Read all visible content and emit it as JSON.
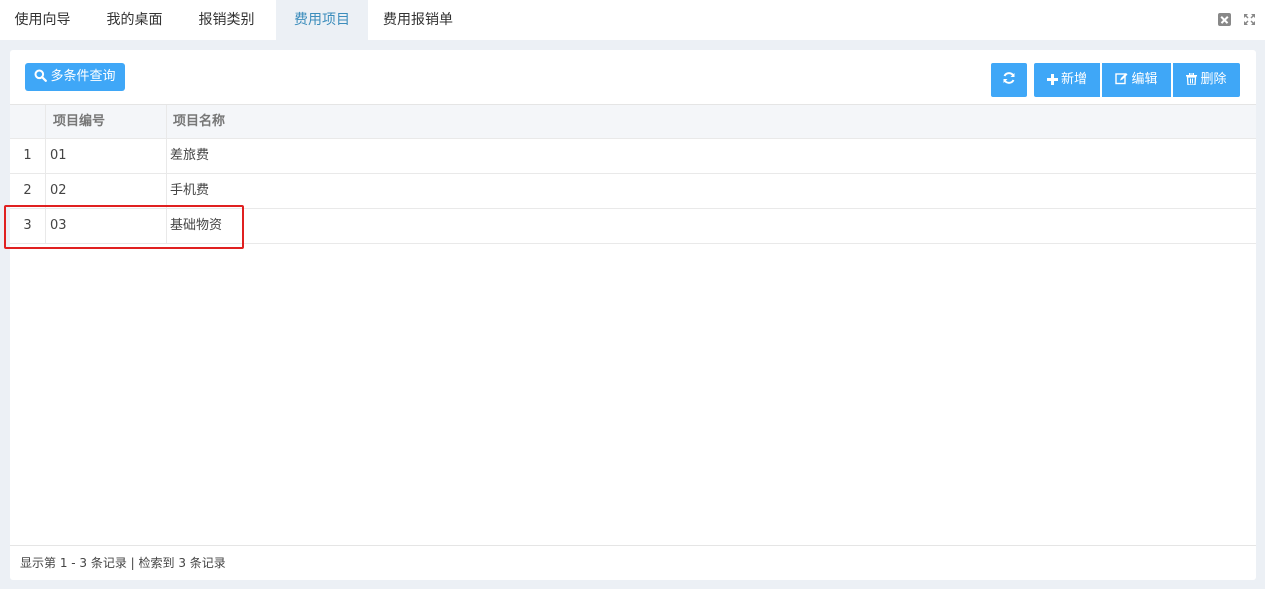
{
  "tabs": [
    {
      "label": "使用向导",
      "active": false
    },
    {
      "label": "我的桌面",
      "active": false
    },
    {
      "label": "报销类别",
      "active": false
    },
    {
      "label": "费用项目",
      "active": true
    },
    {
      "label": "费用报销单",
      "active": false
    }
  ],
  "toolbar": {
    "query_label": "多条件查询",
    "add_label": "新增",
    "edit_label": "编辑",
    "delete_label": "删除"
  },
  "table": {
    "columns": [
      "项目编号",
      "项目名称"
    ],
    "rows": [
      {
        "index": "1",
        "code": "01",
        "name": "差旅费"
      },
      {
        "index": "2",
        "code": "02",
        "name": "手机费"
      },
      {
        "index": "3",
        "code": "03",
        "name": "基础物资"
      }
    ]
  },
  "footer": {
    "summary": "显示第 1 - 3 条记录 | 检索到 3 条记录"
  },
  "colors": {
    "accent": "#3fa7f7",
    "highlight": "#e02020",
    "active_tab": "#3c8dbc"
  },
  "icons": {
    "query": "search-icon",
    "refresh": "refresh-icon",
    "add": "plus-icon",
    "edit": "edit-icon",
    "delete": "trash-icon",
    "close_all": "close-icon",
    "fullscreen": "fullscreen-icon"
  }
}
